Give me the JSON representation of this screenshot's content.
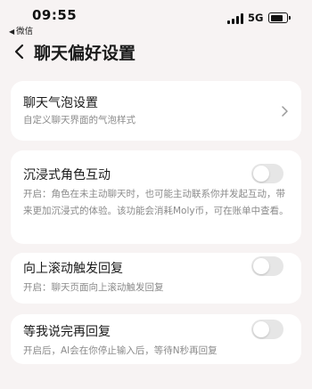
{
  "status_bar": {
    "time": "09:55",
    "back_app_label": "微信",
    "network": "5G",
    "icons": [
      "signal-icon",
      "battery-icon"
    ]
  },
  "header": {
    "back_icon": "chevron-left-icon",
    "title": "聊天偏好设置"
  },
  "settings": {
    "bubble": {
      "title": "聊天气泡设置",
      "description": "自定义聊天界面的气泡样式",
      "icon": "chevron-right-icon"
    },
    "immersive": {
      "title": "沉浸式角色互动",
      "description": "开启：角色在未主动聊天时，也可能主动联系你并发起互动，带来更加沉浸式的体验。该功能会消耗Moly币，可在账单中查看。",
      "enabled": false
    },
    "scroll_up": {
      "title": "向上滚动触发回复",
      "description": "开启：聊天页面向上滚动触发回复",
      "enabled": false
    },
    "wait_reply": {
      "title": "等我说完再回复",
      "description": "开启后，AI会在你停止输入后，等待N秒再回复",
      "enabled": false
    }
  },
  "colors": {
    "background": "#f7f3f3",
    "card": "#ffffff",
    "toggle_off": "#e6e6e6",
    "secondary_text": "#8a8a8a"
  }
}
